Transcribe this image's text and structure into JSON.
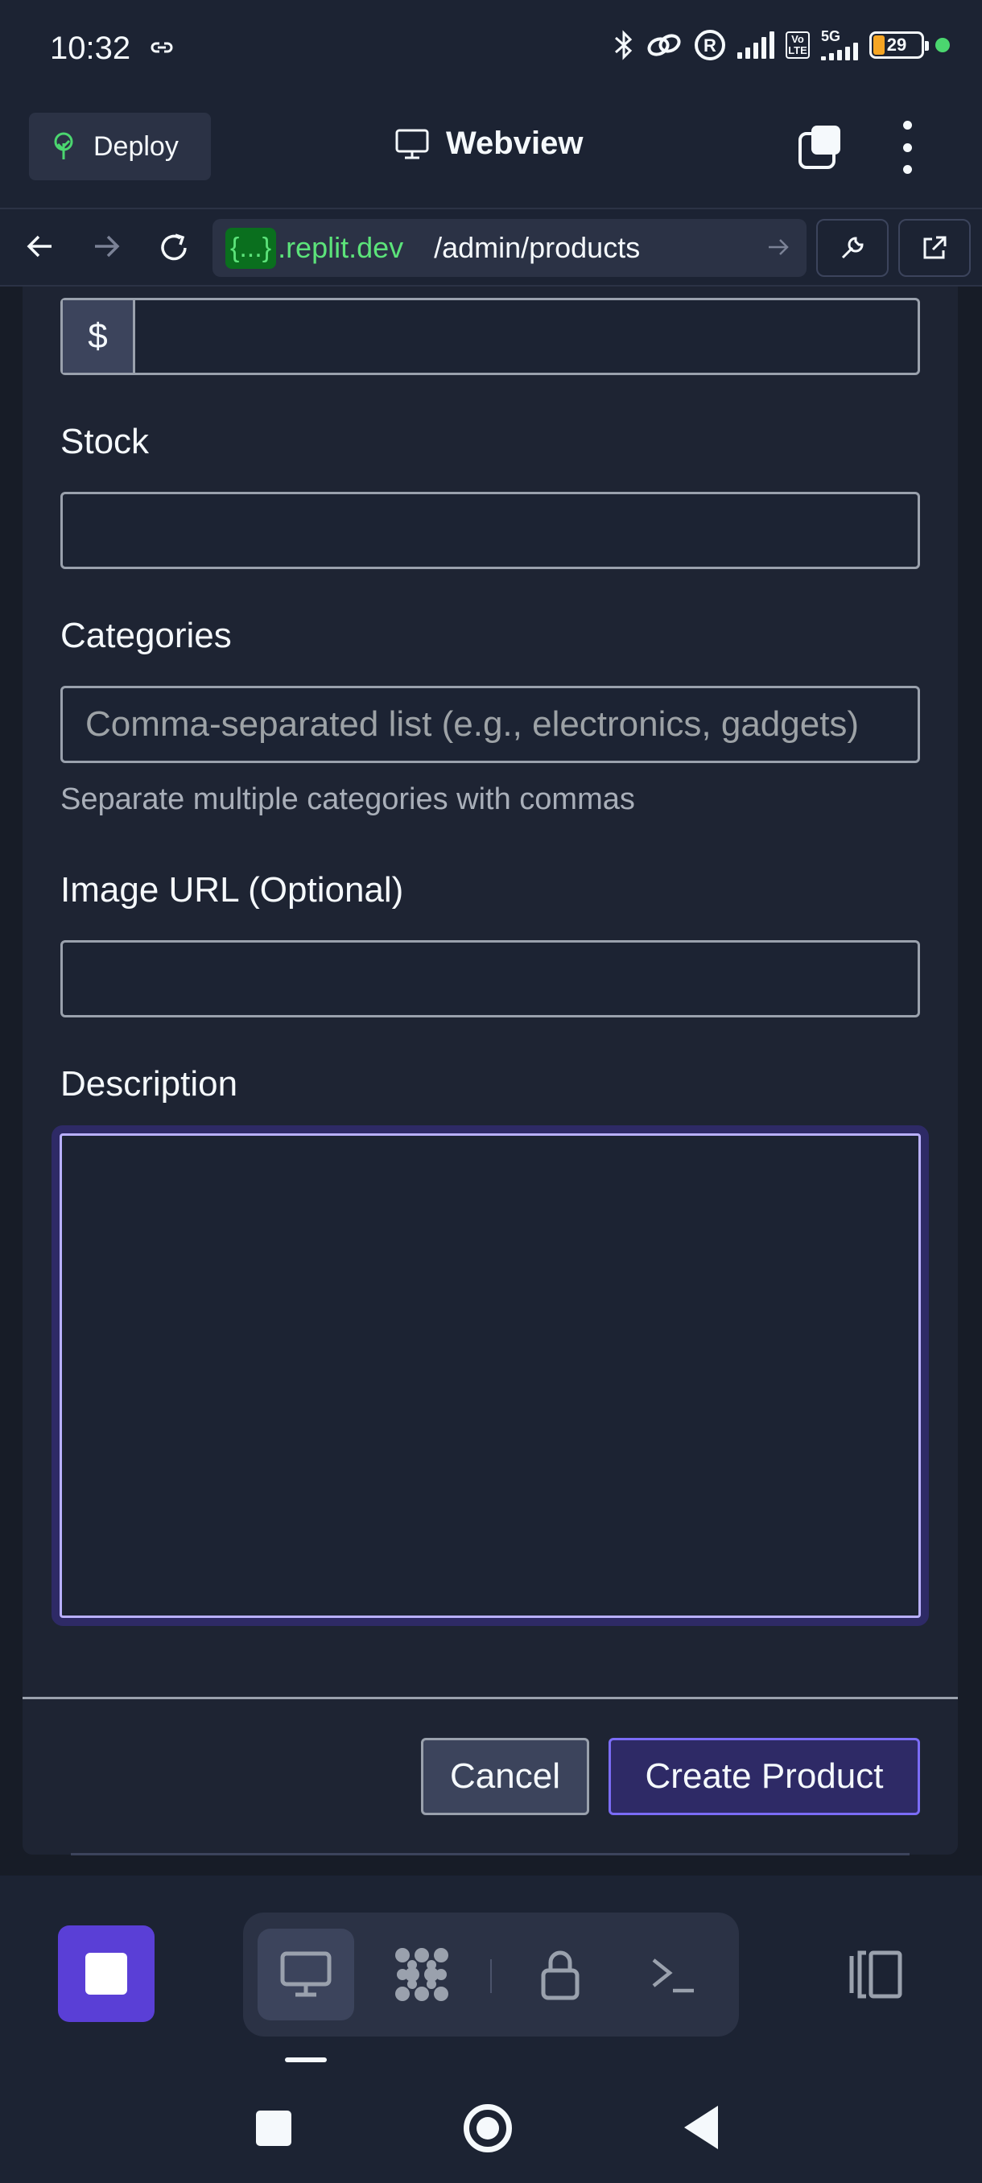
{
  "status_bar": {
    "time": "10:32",
    "battery": "29",
    "network": "5G",
    "volte": "Vo LTE",
    "colors": {
      "battery_fill": "#f5a524",
      "dot": "#4bd66f"
    }
  },
  "header": {
    "deploy_label": "Deploy",
    "title": "Webview"
  },
  "url_bar": {
    "badge": "{...}",
    "domain": ".replit.dev",
    "path": "/admin/products"
  },
  "form": {
    "price": {
      "prefix": "$",
      "value": ""
    },
    "stock": {
      "label": "Stock",
      "value": ""
    },
    "categories": {
      "label": "Categories",
      "placeholder": "Comma-separated list (e.g., electronics, gadgets)",
      "hint": "Separate multiple categories with commas"
    },
    "image_url": {
      "label": "Image URL (Optional)",
      "value": ""
    },
    "description": {
      "label": "Description",
      "value": ""
    },
    "cancel_label": "Cancel",
    "create_label": "Create Product"
  },
  "toolbar": {
    "items": [
      "stop-icon",
      "webview-icon",
      "packager-icon",
      "secrets-icon",
      "shell-icon",
      "side-panel-icon"
    ],
    "accent": "#5a3fd6"
  }
}
